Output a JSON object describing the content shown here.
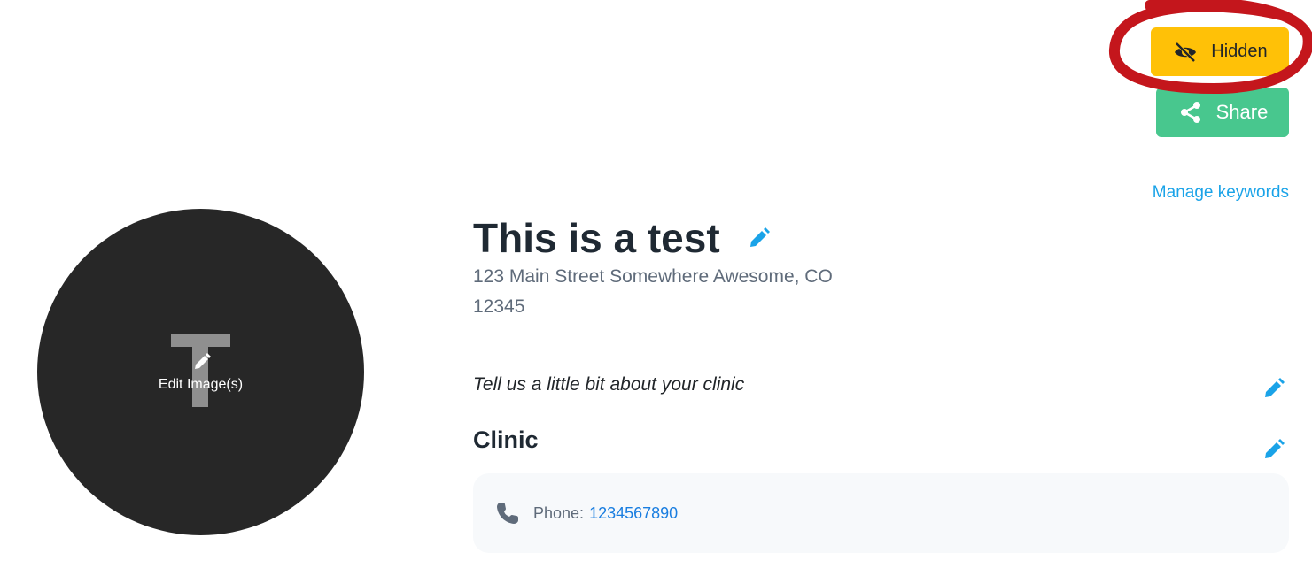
{
  "actions": {
    "hidden_label": "Hidden",
    "share_label": "Share",
    "hidden_icon": "eye-slash-icon",
    "share_icon": "share-icon"
  },
  "manage_keywords_label": "Manage keywords",
  "avatar": {
    "initial": "T",
    "edit_label": "Edit Image(s)"
  },
  "clinic": {
    "title": "This is a test",
    "address_line1": "123 Main Street Somewhere Awesome, CO",
    "address_line2": "12345",
    "about_placeholder": "Tell us a little bit about your clinic",
    "section_heading": "Clinic",
    "phone_label": "Phone:",
    "phone_value": "1234567890"
  },
  "colors": {
    "hidden_button": "#ffc107",
    "share_button": "#48c78e",
    "link": "#1aa3e8",
    "annotation": "#c4161c"
  }
}
